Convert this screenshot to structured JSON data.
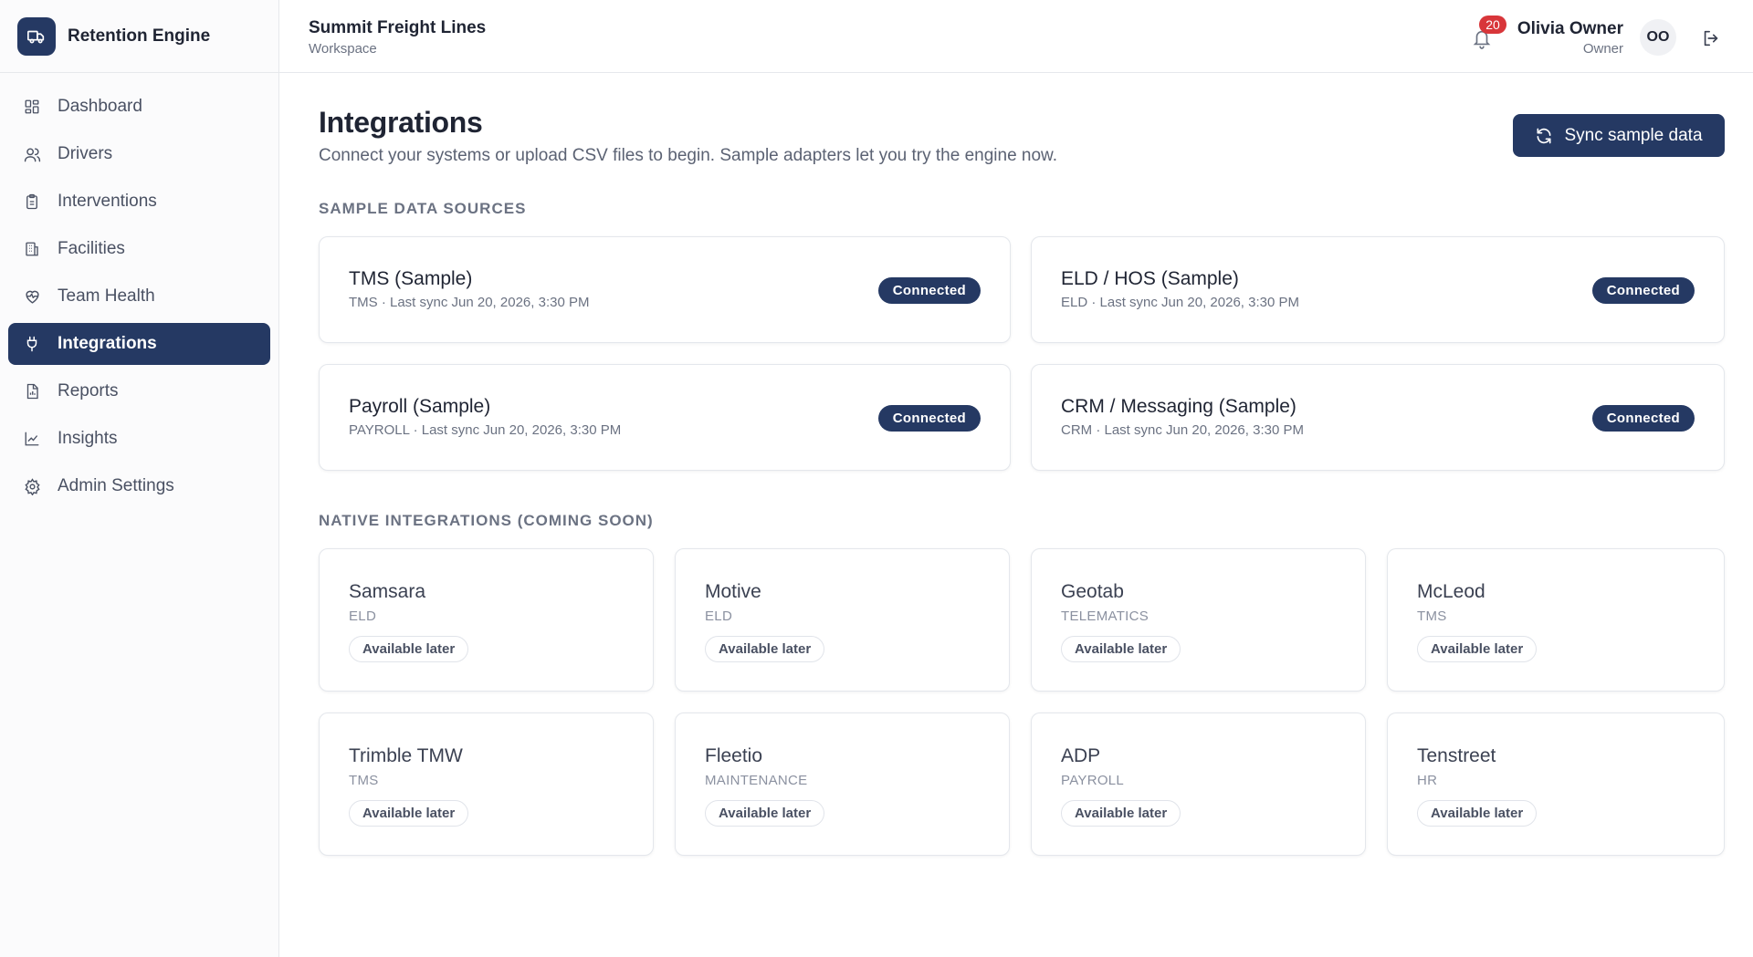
{
  "brand": {
    "name": "Retention Engine"
  },
  "sidebar": {
    "items": [
      {
        "label": "Dashboard",
        "icon": "dashboard-icon",
        "active": false
      },
      {
        "label": "Drivers",
        "icon": "users-icon",
        "active": false
      },
      {
        "label": "Interventions",
        "icon": "clipboard-icon",
        "active": false
      },
      {
        "label": "Facilities",
        "icon": "building-icon",
        "active": false
      },
      {
        "label": "Team Health",
        "icon": "heart-pulse-icon",
        "active": false
      },
      {
        "label": "Integrations",
        "icon": "plug-icon",
        "active": true
      },
      {
        "label": "Reports",
        "icon": "report-icon",
        "active": false
      },
      {
        "label": "Insights",
        "icon": "chart-line-icon",
        "active": false
      },
      {
        "label": "Admin Settings",
        "icon": "gear-icon",
        "active": false
      }
    ]
  },
  "header": {
    "workspace_name": "Summit Freight Lines",
    "workspace_label": "Workspace",
    "notification_count": "20",
    "user_name": "Olivia Owner",
    "user_role": "Owner",
    "avatar_initials": "OO"
  },
  "main": {
    "title": "Integrations",
    "description": "Connect your systems or upload CSV files to begin. Sample adapters let you try the engine now.",
    "sync_label": "Sync sample data",
    "sample_section_title": "SAMPLE DATA SOURCES",
    "native_section_title": "NATIVE INTEGRATIONS (COMING SOON)",
    "sample_sources": [
      {
        "title": "TMS (Sample)",
        "meta": "TMS · Last sync Jun 20, 2026, 3:30 PM",
        "status": "Connected"
      },
      {
        "title": "ELD / HOS (Sample)",
        "meta": "ELD · Last sync Jun 20, 2026, 3:30 PM",
        "status": "Connected"
      },
      {
        "title": "Payroll (Sample)",
        "meta": "PAYROLL · Last sync Jun 20, 2026, 3:30 PM",
        "status": "Connected"
      },
      {
        "title": "CRM / Messaging (Sample)",
        "meta": "CRM · Last sync Jun 20, 2026, 3:30 PM",
        "status": "Connected"
      }
    ],
    "native_integrations": [
      {
        "name": "Samsara",
        "category": "ELD",
        "status": "Available later"
      },
      {
        "name": "Motive",
        "category": "ELD",
        "status": "Available later"
      },
      {
        "name": "Geotab",
        "category": "TELEMATICS",
        "status": "Available later"
      },
      {
        "name": "McLeod",
        "category": "TMS",
        "status": "Available later"
      },
      {
        "name": "Trimble TMW",
        "category": "TMS",
        "status": "Available later"
      },
      {
        "name": "Fleetio",
        "category": "MAINTENANCE",
        "status": "Available later"
      },
      {
        "name": "ADP",
        "category": "PAYROLL",
        "status": "Available later"
      },
      {
        "name": "Tenstreet",
        "category": "HR",
        "status": "Available later"
      }
    ]
  },
  "colors": {
    "primary": "#253963",
    "badge_red": "#d8363a"
  }
}
